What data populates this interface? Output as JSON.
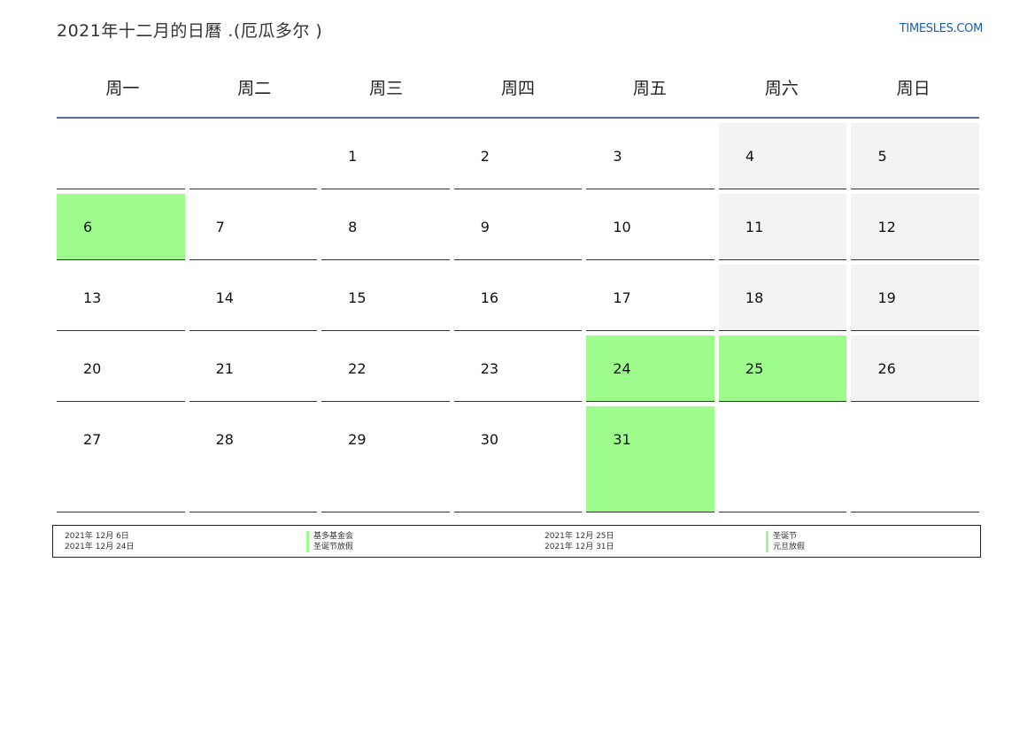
{
  "header": {
    "title": "2021年十二月的日曆 .(厄瓜多尔 )",
    "brand": "TIMESLES.COM"
  },
  "weekdays": [
    "周一",
    "周二",
    "周三",
    "周四",
    "周五",
    "周六",
    "周日"
  ],
  "weeks": [
    [
      {
        "day": "",
        "type": "empty"
      },
      {
        "day": "",
        "type": "empty"
      },
      {
        "day": "1",
        "type": "normal"
      },
      {
        "day": "2",
        "type": "normal"
      },
      {
        "day": "3",
        "type": "normal"
      },
      {
        "day": "4",
        "type": "weekend"
      },
      {
        "day": "5",
        "type": "weekend"
      }
    ],
    [
      {
        "day": "6",
        "type": "holiday"
      },
      {
        "day": "7",
        "type": "normal"
      },
      {
        "day": "8",
        "type": "normal"
      },
      {
        "day": "9",
        "type": "normal"
      },
      {
        "day": "10",
        "type": "normal"
      },
      {
        "day": "11",
        "type": "weekend"
      },
      {
        "day": "12",
        "type": "weekend"
      }
    ],
    [
      {
        "day": "13",
        "type": "normal"
      },
      {
        "day": "14",
        "type": "normal"
      },
      {
        "day": "15",
        "type": "normal"
      },
      {
        "day": "16",
        "type": "normal"
      },
      {
        "day": "17",
        "type": "normal"
      },
      {
        "day": "18",
        "type": "weekend"
      },
      {
        "day": "19",
        "type": "weekend"
      }
    ],
    [
      {
        "day": "20",
        "type": "normal"
      },
      {
        "day": "21",
        "type": "normal"
      },
      {
        "day": "22",
        "type": "normal"
      },
      {
        "day": "23",
        "type": "normal"
      },
      {
        "day": "24",
        "type": "holiday"
      },
      {
        "day": "25",
        "type": "holiday"
      },
      {
        "day": "26",
        "type": "weekend"
      }
    ],
    [
      {
        "day": "27",
        "type": "normal"
      },
      {
        "day": "28",
        "type": "normal"
      },
      {
        "day": "29",
        "type": "normal"
      },
      {
        "day": "30",
        "type": "normal"
      },
      {
        "day": "31",
        "type": "holiday"
      },
      {
        "day": "",
        "type": "empty"
      },
      {
        "day": "",
        "type": "empty"
      }
    ]
  ],
  "legend": {
    "col1": [
      "2021年 12月 6日",
      "2021年 12月 24日"
    ],
    "col2": [
      "基多基金会",
      "圣诞节放假"
    ],
    "col3": [
      "2021年 12月 25日",
      "2021年 12月 31日"
    ],
    "col4": [
      "圣诞节",
      "元旦放假"
    ]
  },
  "colors": {
    "holiday": "#9efc8c",
    "weekend": "#f3f3f3",
    "header_rule": "#5a7190",
    "brand": "#1a5fa8"
  }
}
